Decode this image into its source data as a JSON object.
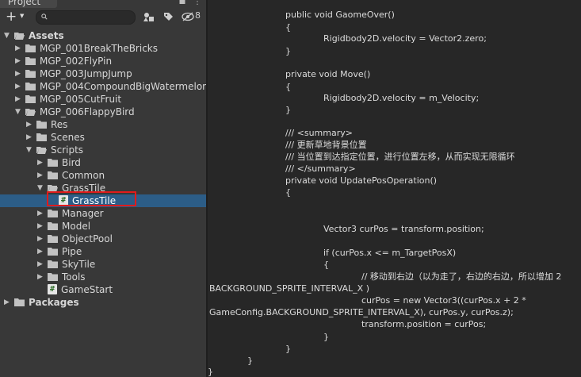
{
  "panel": {
    "title": "Project",
    "lock_icon": "lock-icon",
    "menu_icon": "kebab-menu-icon"
  },
  "toolbar": {
    "create_label": "+",
    "search_placeholder": "",
    "hidden_count": "8"
  },
  "tree": [
    {
      "label": "Assets",
      "bold": true,
      "kind": "folder",
      "expanded": true
    },
    {
      "label": "MGP_001BreakTheBricks",
      "kind": "folder",
      "expanded": false
    },
    {
      "label": "MGP_002FlyPin",
      "kind": "folder",
      "expanded": false
    },
    {
      "label": "MGP_003JumpJump",
      "kind": "folder",
      "expanded": false
    },
    {
      "label": "MGP_004CompoundBigWatermelon",
      "kind": "folder",
      "expanded": false
    },
    {
      "label": "MGP_005CutFruit",
      "kind": "folder",
      "expanded": false
    },
    {
      "label": "MGP_006FlappyBird",
      "kind": "folder",
      "expanded": true
    },
    {
      "label": "Res",
      "kind": "folder",
      "expanded": false
    },
    {
      "label": "Scenes",
      "kind": "folder",
      "expanded": false
    },
    {
      "label": "Scripts",
      "kind": "folder",
      "expanded": true
    },
    {
      "label": "Bird",
      "kind": "folder",
      "expanded": false
    },
    {
      "label": "Common",
      "kind": "folder",
      "expanded": false
    },
    {
      "label": "GrassTile",
      "kind": "folder",
      "expanded": true
    },
    {
      "label": "GrassTile",
      "kind": "script",
      "selected": true
    },
    {
      "label": "Manager",
      "kind": "folder",
      "expanded": false
    },
    {
      "label": "Model",
      "kind": "folder",
      "expanded": false
    },
    {
      "label": "ObjectPool",
      "kind": "folder",
      "expanded": false
    },
    {
      "label": "Pipe",
      "kind": "folder",
      "expanded": false
    },
    {
      "label": "SkyTile",
      "kind": "folder",
      "expanded": false
    },
    {
      "label": "Tools",
      "kind": "folder",
      "expanded": false
    },
    {
      "label": "GameStart",
      "kind": "script"
    },
    {
      "label": "Packages",
      "bold": true,
      "kind": "folder",
      "expanded": false
    }
  ],
  "code_lines": [
    "public void GaomeOver()",
    "{",
    "Rigidbody2D.velocity = Vector2.zero;",
    "}",
    "private void Move()",
    "{",
    "Rigidbody2D.velocity = m_Velocity;",
    "}",
    "/// <summary>",
    "/// 更新草地背景位置",
    "/// 当位置到达指定位置，进行位置左移，从而实现无限循环",
    "/// </summary>",
    "private void UpdatePosOperation()",
    "{",
    "Vector3 curPos = transform.position;",
    "if (curPos.x <= m_TargetPosX)",
    "{",
    "// 移动到右边（以为走了，右边的右边，所以增加 2",
    "BACKGROUND_SPRITE_INTERVAL_X )",
    "curPos = new Vector3((curPos.x + 2 *",
    "GameConfig.BACKGROUND_SPRITE_INTERVAL_X), curPos.y, curPos.z);",
    "transform.position = curPos;",
    "}",
    "}",
    "}",
    "}"
  ]
}
